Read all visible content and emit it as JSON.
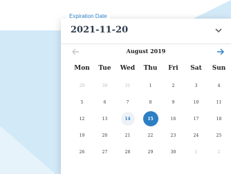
{
  "field": {
    "label": "Expiration Date",
    "value": "2021-11-20"
  },
  "calendar": {
    "month": "August 2019",
    "weekdays": [
      "Mon",
      "Tue",
      "Wed",
      "Thu",
      "Fri",
      "Sat",
      "Sun"
    ],
    "weeks": [
      [
        "29",
        "30",
        "31",
        "1",
        "2",
        "3",
        "4"
      ],
      [
        "5",
        "6",
        "7",
        "8",
        "9",
        "10",
        "11"
      ],
      [
        "12",
        "13",
        "14",
        "15",
        "16",
        "17",
        "18"
      ],
      [
        "19",
        "20",
        "21",
        "22",
        "23",
        "24",
        "25"
      ],
      [
        "26",
        "27",
        "28",
        "29",
        "30",
        "1",
        "2"
      ]
    ],
    "today": "14",
    "selected": "15"
  },
  "colors": {
    "accent": "#2d7fc4",
    "background_shape": "#d2e9f7"
  },
  "icons": {
    "dropdown": "chevron-down-icon",
    "prev": "arrow-left-icon",
    "next": "arrow-right-icon"
  }
}
